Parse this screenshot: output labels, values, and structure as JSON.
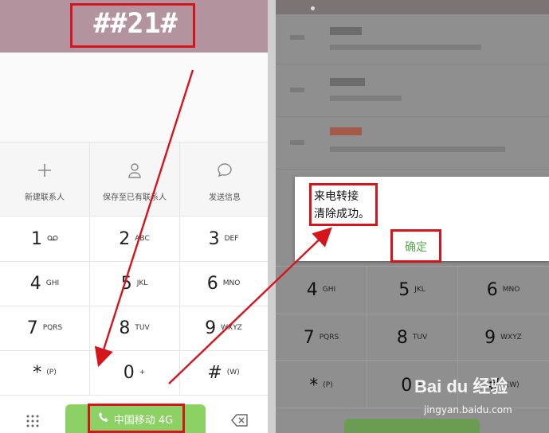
{
  "left": {
    "dialed_number": "##21#",
    "actions": [
      {
        "icon": "plus-icon",
        "label": "新建联系人"
      },
      {
        "icon": "person-icon",
        "label": "保存至已有联系人"
      },
      {
        "icon": "chat-bubble-icon",
        "label": "发送信息"
      }
    ],
    "keys": [
      {
        "digit": "1",
        "letters": "voicemail"
      },
      {
        "digit": "2",
        "letters": "ABC"
      },
      {
        "digit": "3",
        "letters": "DEF"
      },
      {
        "digit": "4",
        "letters": "GHI"
      },
      {
        "digit": "5",
        "letters": "JKL"
      },
      {
        "digit": "6",
        "letters": "MNO"
      },
      {
        "digit": "7",
        "letters": "PQRS"
      },
      {
        "digit": "8",
        "letters": "TUV"
      },
      {
        "digit": "9",
        "letters": "WXYZ"
      },
      {
        "digit": "*",
        "letters": "(P)"
      },
      {
        "digit": "0",
        "letters": "+"
      },
      {
        "digit": "#",
        "letters": "(W)"
      }
    ],
    "call_button": "中国移动 4G"
  },
  "right": {
    "dialog": {
      "line1": "来电转接",
      "line2": "清除成功。",
      "confirm": "确定"
    },
    "keys": [
      {
        "digit": "4",
        "letters": "GHI"
      },
      {
        "digit": "5",
        "letters": "JKL"
      },
      {
        "digit": "6",
        "letters": "MNO"
      },
      {
        "digit": "7",
        "letters": "PQRS"
      },
      {
        "digit": "8",
        "letters": "TUV"
      },
      {
        "digit": "9",
        "letters": "WXYZ"
      },
      {
        "digit": "*",
        "letters": "(P)"
      },
      {
        "digit": "0",
        "letters": "+"
      },
      {
        "digit": "#",
        "letters": "(W)"
      }
    ]
  },
  "watermark": {
    "logo": "Bai du 经验",
    "url": "jingyan.baidu.com"
  },
  "colors": {
    "annotation_red": "#d6141b",
    "call_green": "#8bd164",
    "confirm_green": "#5aa84d",
    "header_mauve": "#b3939e"
  }
}
